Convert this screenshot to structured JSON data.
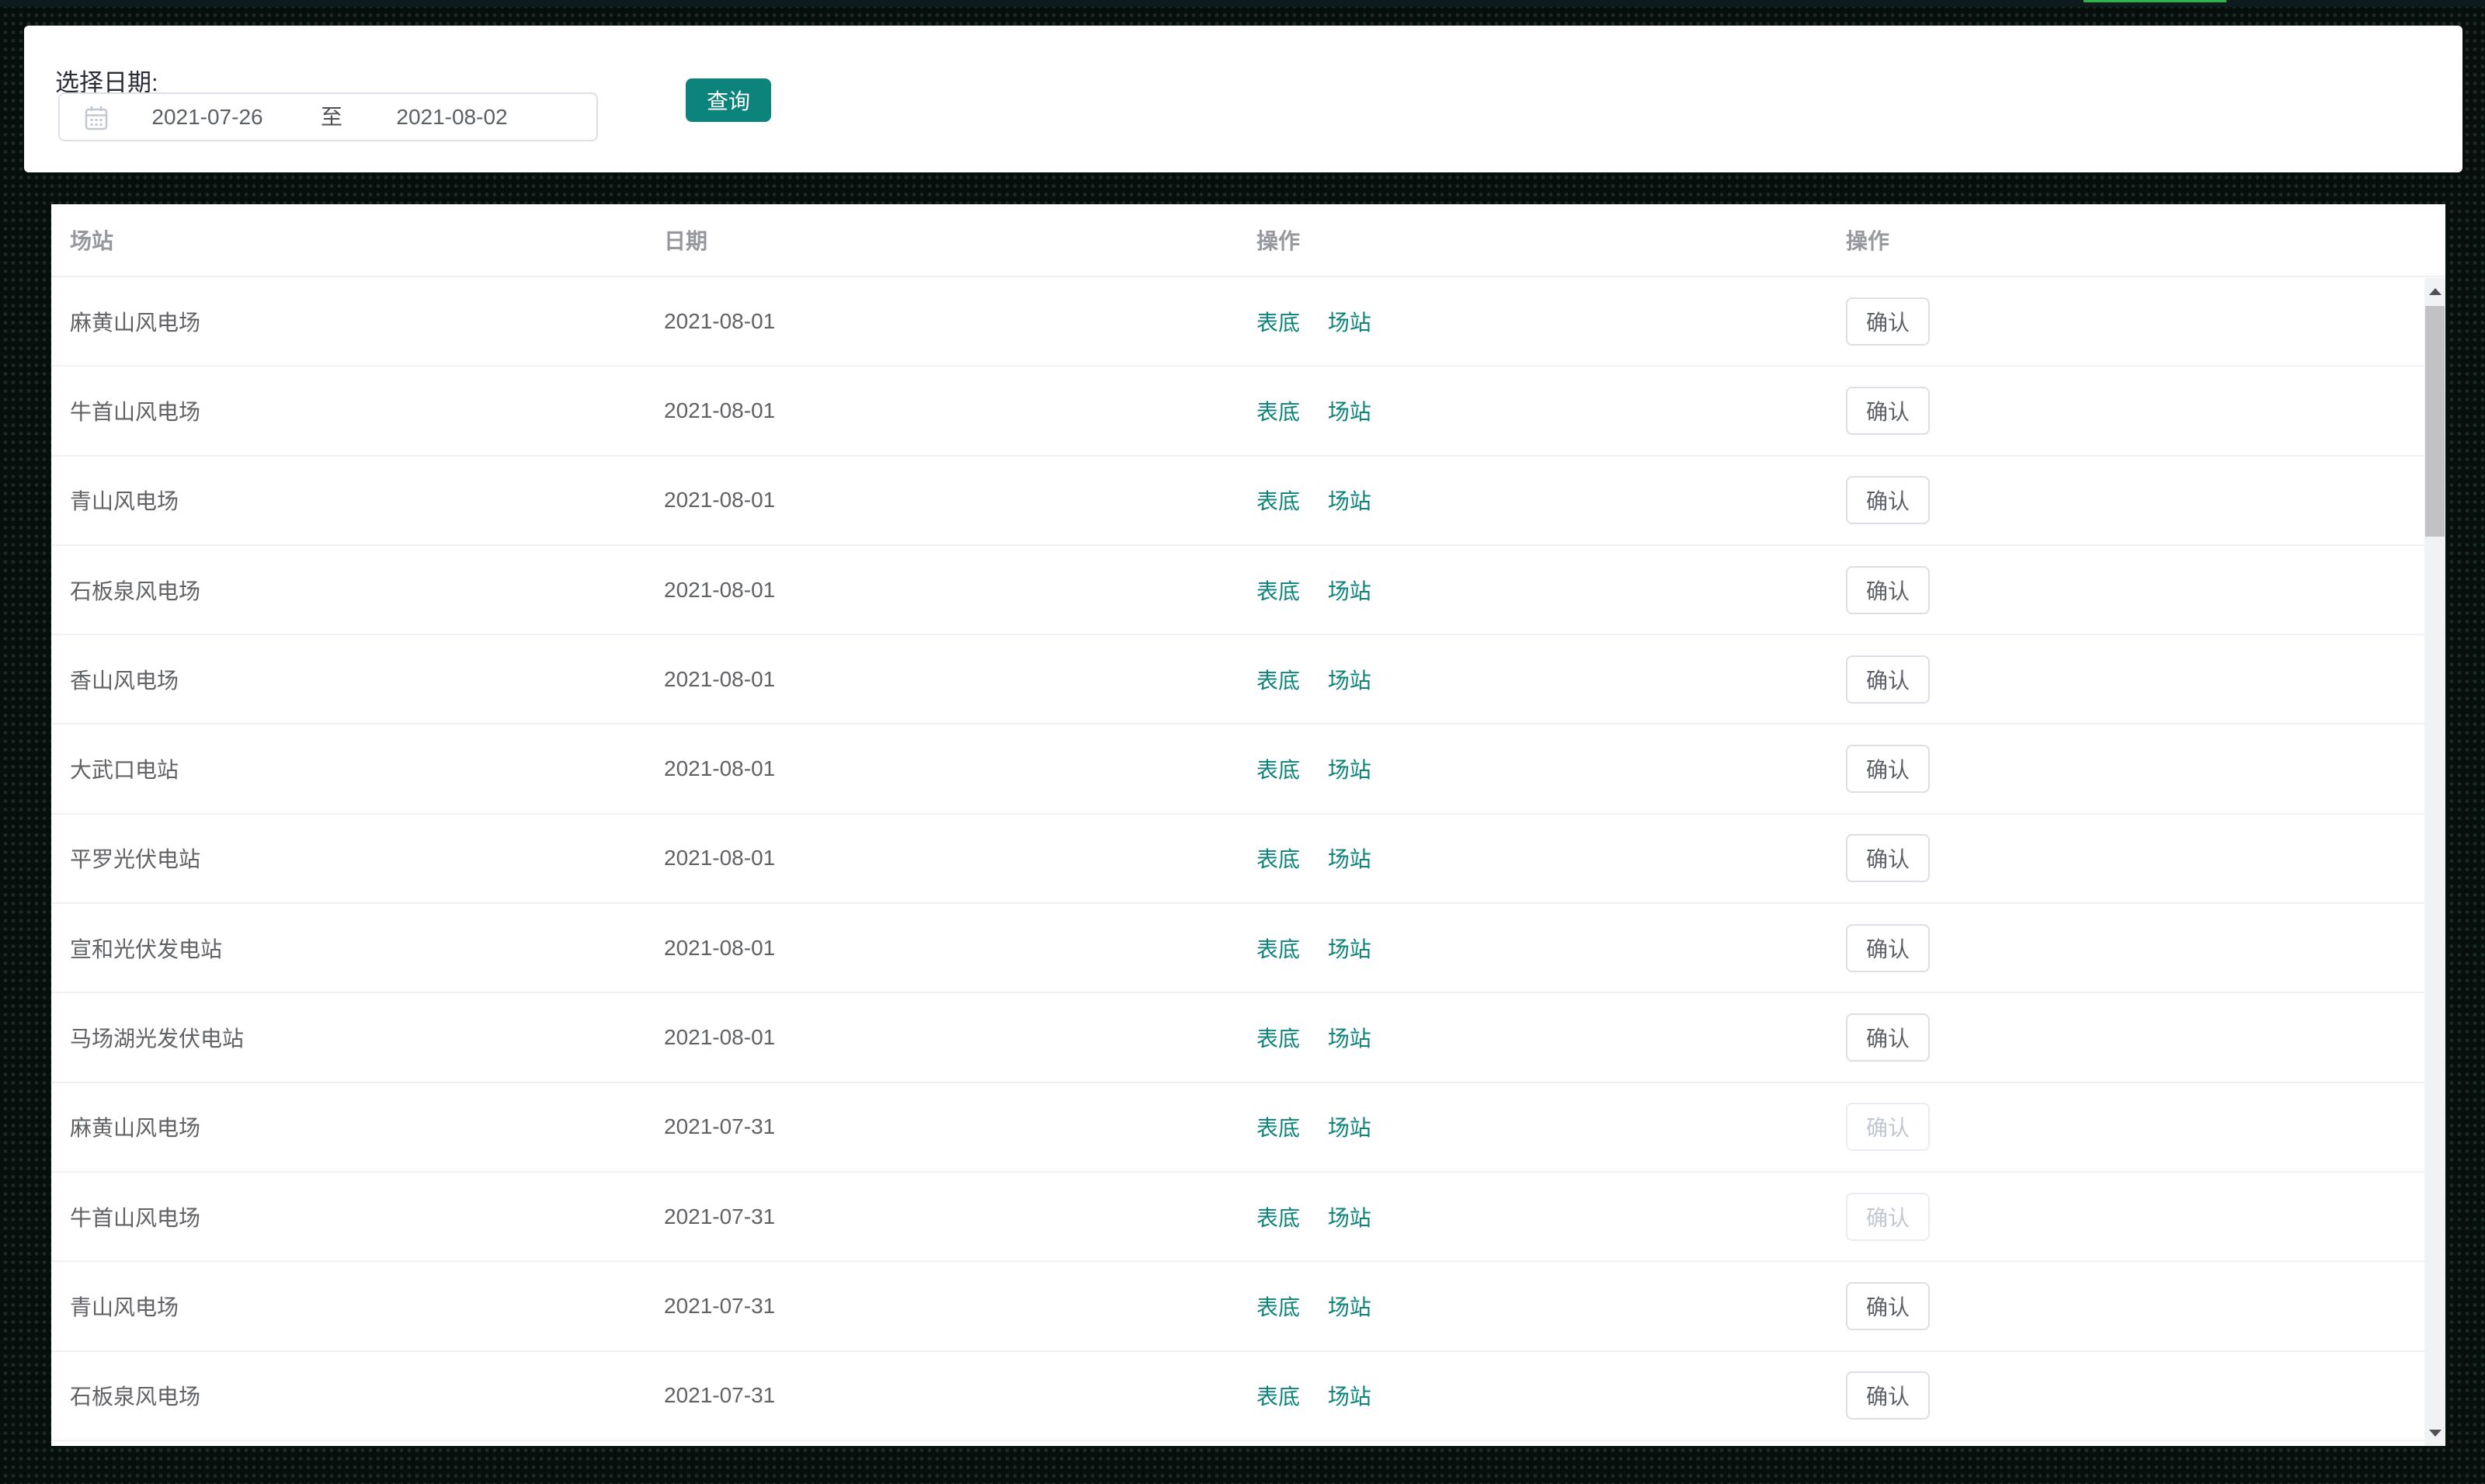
{
  "colors": {
    "accent_teal": "#0c837b",
    "page_background": "#070f0c",
    "top_green_bar": "#2eb344",
    "link_teal": "#0c837b",
    "disabled_text": "#c2c6cf"
  },
  "icons": {
    "calendar": "calendar-icon",
    "scroll_up": "triangle-up-icon",
    "scroll_down": "triangle-down-icon"
  },
  "filter": {
    "label": "选择日期:",
    "date_start": "2021-07-26",
    "date_separator": "至",
    "date_end": "2021-08-02",
    "search_button": "查询"
  },
  "table": {
    "headers": [
      "场站",
      "日期",
      "操作",
      "操作"
    ],
    "link_labels": [
      "表底",
      "场站"
    ],
    "confirm_label": "确认",
    "rows": [
      {
        "station": "麻黄山风电场",
        "date": "2021-08-01",
        "confirm_disabled": false
      },
      {
        "station": "牛首山风电场",
        "date": "2021-08-01",
        "confirm_disabled": false
      },
      {
        "station": "青山风电场",
        "date": "2021-08-01",
        "confirm_disabled": false
      },
      {
        "station": "石板泉风电场",
        "date": "2021-08-01",
        "confirm_disabled": false
      },
      {
        "station": "香山风电场",
        "date": "2021-08-01",
        "confirm_disabled": false
      },
      {
        "station": "大武口电站",
        "date": "2021-08-01",
        "confirm_disabled": false
      },
      {
        "station": "平罗光伏电站",
        "date": "2021-08-01",
        "confirm_disabled": false
      },
      {
        "station": "宣和光伏发电站",
        "date": "2021-08-01",
        "confirm_disabled": false
      },
      {
        "station": "马场湖光发伏电站",
        "date": "2021-08-01",
        "confirm_disabled": false
      },
      {
        "station": "麻黄山风电场",
        "date": "2021-07-31",
        "confirm_disabled": true
      },
      {
        "station": "牛首山风电场",
        "date": "2021-07-31",
        "confirm_disabled": true
      },
      {
        "station": "青山风电场",
        "date": "2021-07-31",
        "confirm_disabled": false
      },
      {
        "station": "石板泉风电场",
        "date": "2021-07-31",
        "confirm_disabled": false
      }
    ]
  }
}
